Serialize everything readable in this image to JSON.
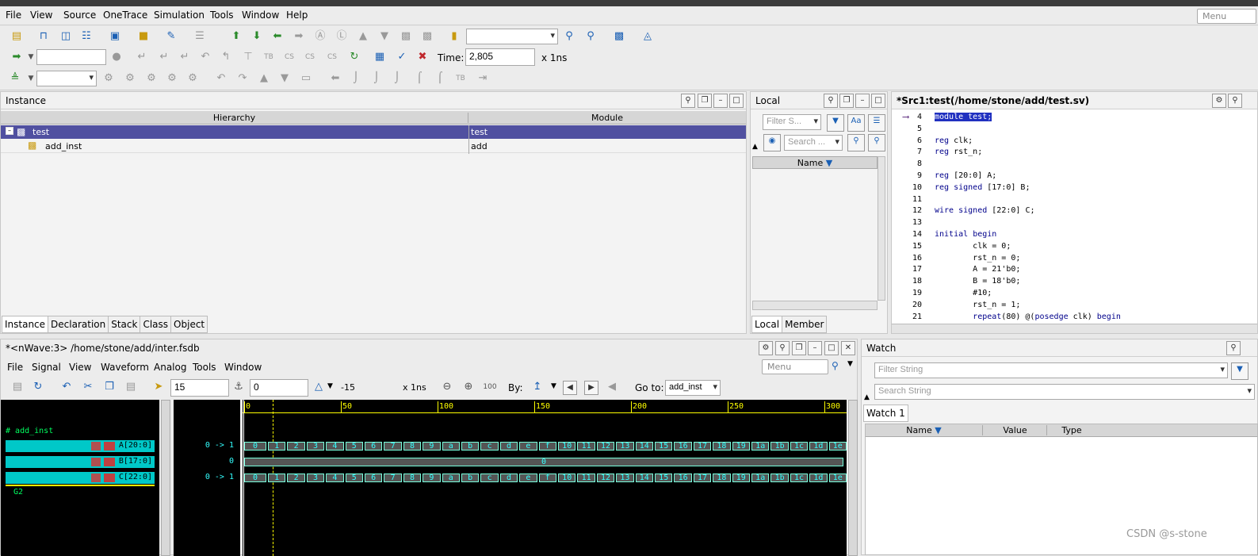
{
  "app": {
    "menu_placeholder": "Menu"
  },
  "menubar": [
    "File",
    "View",
    "Source",
    "OneTrace",
    "Simulation",
    "Tools",
    "Window",
    "Help"
  ],
  "toolbar": {
    "time_label": "Time:",
    "time_value": "2,805",
    "time_unit": "x 1ns"
  },
  "instance_panel": {
    "title": "Instance",
    "columns": [
      "Hierarchy",
      "Module"
    ],
    "rows": [
      {
        "name": "test",
        "module": "test"
      },
      {
        "name": "add_inst",
        "module": "add"
      }
    ],
    "tabs": [
      "Instance",
      "Declaration",
      "Stack",
      "Class",
      "Object"
    ]
  },
  "local_panel": {
    "title": "Local",
    "filter_placeholder": "Filter S...",
    "search_placeholder": "Search ...",
    "column": "Name",
    "tabs": [
      "Local",
      "Member"
    ]
  },
  "source_panel": {
    "title": "*Src1:test(/home/stone/add/test.sv)",
    "lines": [
      {
        "n": "4",
        "t": "module test;"
      },
      {
        "n": "5",
        "t": ""
      },
      {
        "n": "6",
        "t": "reg clk;"
      },
      {
        "n": "7",
        "t": "reg rst_n;"
      },
      {
        "n": "8",
        "t": ""
      },
      {
        "n": "9",
        "t": "reg [20:0] A;"
      },
      {
        "n": "10",
        "t": "reg signed [17:0] B;"
      },
      {
        "n": "11",
        "t": ""
      },
      {
        "n": "12",
        "t": "wire signed [22:0] C;"
      },
      {
        "n": "13",
        "t": ""
      },
      {
        "n": "14",
        "t": "initial begin"
      },
      {
        "n": "15",
        "t": "        clk = 0;"
      },
      {
        "n": "16",
        "t": "        rst_n = 0;"
      },
      {
        "n": "17",
        "t": "        A = 21'b0;"
      },
      {
        "n": "18",
        "t": "        B = 18'b0;"
      },
      {
        "n": "19",
        "t": "        #10;"
      },
      {
        "n": "20",
        "t": "        rst_n = 1;"
      },
      {
        "n": "21",
        "t": "        repeat(80) @(posedge clk) begin"
      }
    ]
  },
  "nwave": {
    "title": "*<nWave:3> /home/stone/add/inter.fsdb",
    "menus": [
      "File",
      "Signal",
      "View",
      "Waveform",
      "Analog",
      "Tools",
      "Window"
    ],
    "menu_placeholder": "Menu",
    "cursor_value": "15",
    "marker_value": "0",
    "delta": "-15",
    "unit": "x 1ns",
    "by_label": "By:",
    "goto_label": "Go to:",
    "goto_value": "add_inst",
    "group_name": "add_inst",
    "group2": "G2",
    "signals": [
      {
        "name": "A[20:0]",
        "value": "0 -> 1"
      },
      {
        "name": "B[17:0]",
        "value": "0"
      },
      {
        "name": "C[22:0]",
        "value": "0 -> 1"
      }
    ],
    "ticks": [
      "0",
      "50",
      "100",
      "150",
      "200",
      "250",
      "300"
    ],
    "seq": [
      "0",
      "1",
      "2",
      "3",
      "4",
      "5",
      "6",
      "7",
      "8",
      "9",
      "a",
      "b",
      "c",
      "d",
      "e",
      "f",
      "10",
      "11",
      "12",
      "13",
      "14",
      "15",
      "16",
      "17",
      "18",
      "19",
      "1a",
      "1b",
      "1c",
      "1d",
      "1e"
    ],
    "b_const": "0"
  },
  "watch": {
    "title": "Watch",
    "filter_placeholder": "Filter String",
    "search_placeholder": "Search String",
    "tab": "Watch 1",
    "columns": [
      "Name",
      "Value",
      "Type"
    ]
  },
  "watermark": "CSDN @s-stone"
}
